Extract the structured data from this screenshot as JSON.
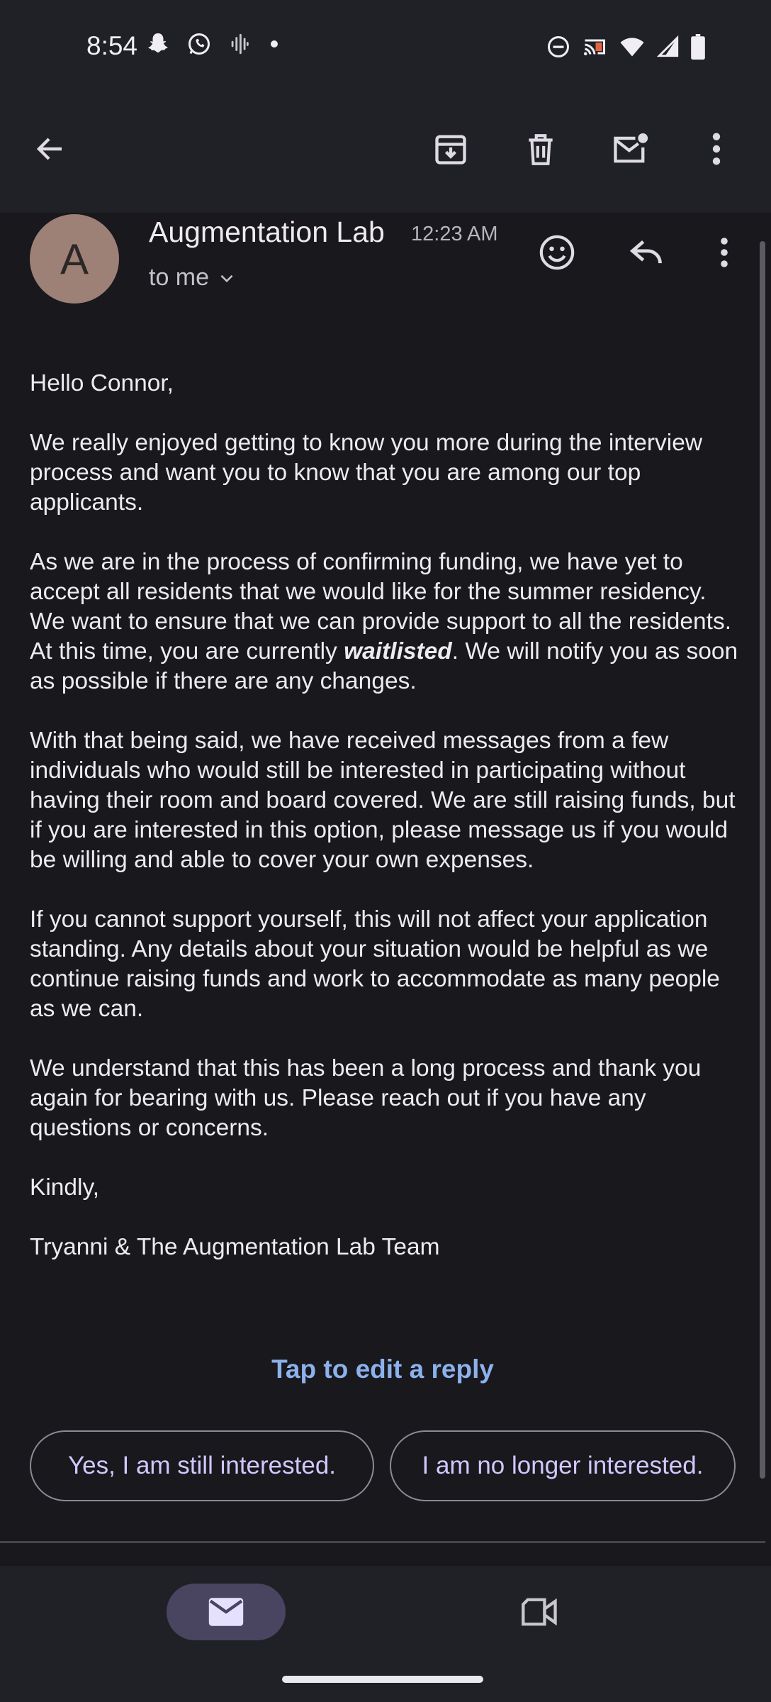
{
  "status_bar": {
    "time": "8:54",
    "left_icons": [
      "snapchat-icon",
      "whatsapp-icon",
      "voice-wave-icon",
      "dot-icon"
    ],
    "right_icons": [
      "do-not-disturb-icon",
      "cast-icon",
      "wifi-icon",
      "signal-icon",
      "battery-icon"
    ]
  },
  "toolbar": {
    "icons": [
      "back-arrow-icon",
      "archive-icon",
      "delete-icon",
      "mark-unread-icon",
      "more-vert-icon"
    ]
  },
  "email": {
    "avatar_letter": "A",
    "sender": "Augmentation Lab",
    "time": "12:23 AM",
    "to": "to me",
    "paragraphs": {
      "greeting": "Hello Connor,",
      "p1": "We really enjoyed getting to know you more during the interview process and want you to know that you are among our top applicants.",
      "p2_before": "As we are in the process of confirming funding, we have yet to accept all residents that we would like for the summer residency. We want to ensure that we can provide support to all the residents. At this time, you are currently ",
      "p2_emphasis": "waitlisted",
      "p2_after": ". We will notify you as soon as possible if there are any changes.",
      "p3": "With that being said, we have received messages from a few individuals who would still be interested in participating without having their room and board covered. We are still raising funds, but if you are interested in this option, please message us if you would be willing and able to cover your own expenses.",
      "p4": "If you cannot support yourself, this will not affect your application standing. Any details about your situation would be helpful as we continue raising funds and work to accommodate as many people as we can.",
      "p5": "We understand that this has been a long process and thank you again for bearing with us. Please reach out if you have any questions or concerns.",
      "closing": "Kindly,",
      "signature": "Tryanni & The Augmentation Lab Team"
    }
  },
  "reply": {
    "tap_label": "Tap to edit a reply",
    "smart_replies": [
      "Yes, I am still interested.",
      "I am no longer interested."
    ]
  },
  "bottom_nav": {
    "items": [
      "mail-icon",
      "video-icon"
    ]
  }
}
